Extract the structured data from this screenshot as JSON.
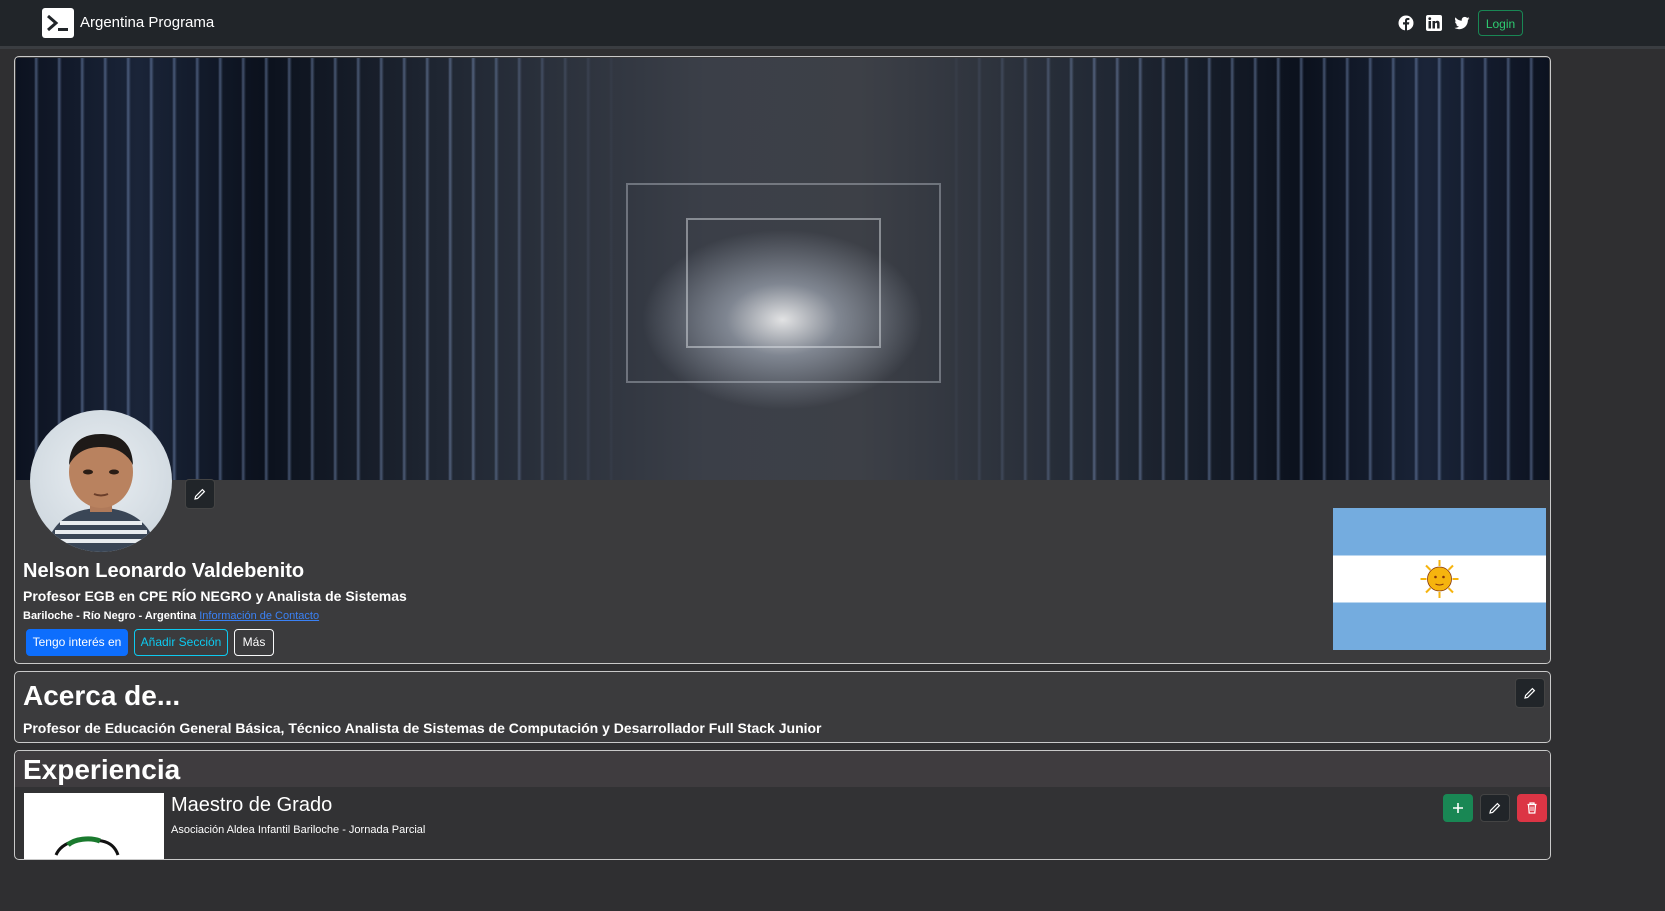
{
  "navbar": {
    "brand": "Argentina Programa",
    "icons": [
      "terminal-icon",
      "facebook-icon",
      "linkedin-icon",
      "twitter-icon"
    ],
    "login_label": "Login"
  },
  "profile": {
    "name": "Nelson Leonardo Valdebenito",
    "headline": "Profesor EGB en CPE RÍO NEGRO y Analista de Sistemas",
    "location": "Bariloche - Río Negro - Argentina",
    "contact_link": "Información de Contacto",
    "buttons": {
      "interests": "Tengo interés en",
      "add_section": "Añadir Sección",
      "more": "Más"
    }
  },
  "about": {
    "title": "Acerca de...",
    "text": "Profesor de Educación General Básica, Técnico Analista de Sistemas de Computación y Desarrollador Full Stack Junior"
  },
  "experience": {
    "title": "Experiencia",
    "items": [
      {
        "title": "Maestro de Grado",
        "company": "Asociación Aldea Infantil Bariloche - Jornada Parcial"
      }
    ]
  },
  "colors": {
    "navbar_bg": "#212529",
    "primary": "#0d6efd",
    "info": "#0dcaf0",
    "success": "#198754",
    "danger": "#dc3545"
  }
}
